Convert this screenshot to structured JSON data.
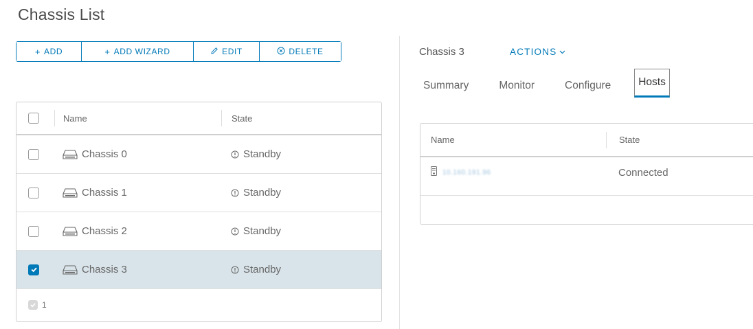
{
  "page": {
    "title": "Chassis List"
  },
  "toolbar": {
    "add": {
      "icon": "plus-icon",
      "label": "ADD"
    },
    "add_wizard": {
      "icon": "plus-icon",
      "label": "ADD WIZARD"
    },
    "edit": {
      "icon": "pencil-icon",
      "label": "EDIT"
    },
    "delete": {
      "icon": "circle-x-icon",
      "label": "DELETE"
    }
  },
  "chassis_grid": {
    "columns": {
      "name": "Name",
      "state": "State"
    },
    "rows": [
      {
        "name": "Chassis 0",
        "state": "Standby",
        "selected": false
      },
      {
        "name": "Chassis 1",
        "state": "Standby",
        "selected": false
      },
      {
        "name": "Chassis 2",
        "state": "Standby",
        "selected": false
      },
      {
        "name": "Chassis 3",
        "state": "Standby",
        "selected": true
      }
    ],
    "footer": {
      "selected_count": "1"
    }
  },
  "detail": {
    "title": "Chassis 3",
    "actions_label": "ACTIONS",
    "tabs": [
      {
        "label": "Summary",
        "active": false
      },
      {
        "label": "Monitor",
        "active": false
      },
      {
        "label": "Configure",
        "active": false
      },
      {
        "label": "Hosts",
        "active": true
      }
    ],
    "hosts_grid": {
      "columns": {
        "name": "Name",
        "state": "State"
      },
      "rows": [
        {
          "name": "10.160.191.96",
          "state": "Connected"
        }
      ]
    }
  },
  "colors": {
    "accent": "#0079b8",
    "selected_row": "#d9e4ea",
    "border": "#cfcfcf"
  }
}
